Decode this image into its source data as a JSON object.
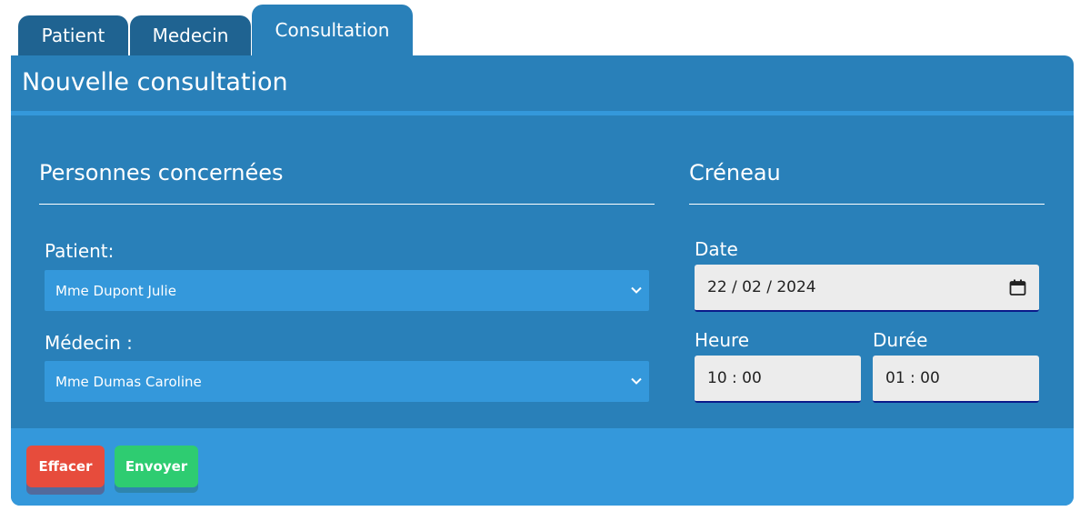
{
  "tabs": {
    "patient": "Patient",
    "medecin": "Medecin",
    "consultation": "Consultation",
    "active": "Consultation"
  },
  "panel": {
    "title": "Nouvelle consultation"
  },
  "persons": {
    "heading": "Personnes concernées",
    "patient_label": "Patient:",
    "patient_value": "Mme Dupont Julie",
    "medecin_label": "Médecin :",
    "medecin_value": "Mme Dumas Caroline"
  },
  "slot": {
    "heading": "Créneau",
    "date_label": "Date",
    "date_value": "22 / 02 / 2024",
    "heure_label": "Heure",
    "heure_value": "10 : 00",
    "duree_label": "Durée",
    "duree_value": "01 : 00"
  },
  "buttons": {
    "clear": "Effacer",
    "send": "Envoyer"
  },
  "icons": {
    "select_arrow": "chevron-down-icon",
    "date_picker": "calendar-icon"
  },
  "colors": {
    "panel": "#2980b9",
    "accent": "#3498db",
    "tab_inactive": "#1f6391",
    "clear_button": "#e74c3c",
    "send_button": "#2ecc71"
  }
}
